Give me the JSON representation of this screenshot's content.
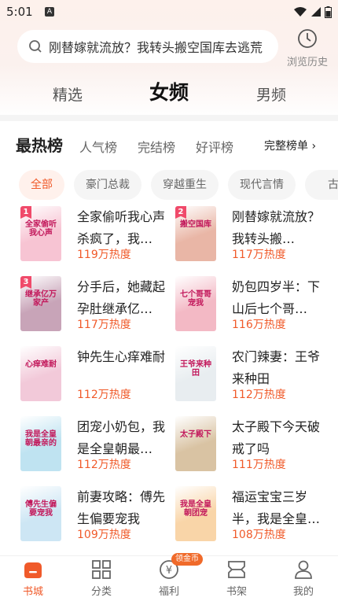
{
  "status": {
    "time": "5:01",
    "notif_letter": "A"
  },
  "search": {
    "placeholder": "刚替嫁就流放？我转头搬空国库去逃荒"
  },
  "history": {
    "label": "浏览历史"
  },
  "tabs": [
    "精选",
    "女频",
    "男频"
  ],
  "ranking": {
    "title": "最热榜",
    "tabs": [
      "人气榜",
      "完结榜",
      "好评榜"
    ],
    "full_list": "完整榜单 ›"
  },
  "chips": [
    "全部",
    "豪门总裁",
    "穿越重生",
    "现代言情",
    "古代"
  ],
  "books": [
    {
      "rank": "1",
      "title": "全家偷听我心声杀疯了，我…",
      "heat": "119万热度",
      "cover_text": "全家偷听我心声",
      "cover_color": "#f7c4d3"
    },
    {
      "rank": "2",
      "title": "刚替嫁就流放？我转头搬…",
      "heat": "117万热度",
      "cover_text": "搬空国库",
      "cover_color": "#e9b6a6"
    },
    {
      "rank": "3",
      "title": "分手后，她藏起孕肚继承亿…",
      "heat": "117万热度",
      "cover_text": "继承亿万家产",
      "cover_color": "#c8a4b8"
    },
    {
      "rank": "",
      "title": "奶包四岁半：下山后七个哥…",
      "heat": "116万热度",
      "cover_text": "七个哥哥宠我",
      "cover_color": "#f3b9c5"
    },
    {
      "rank": "",
      "title": "钟先生心痒难耐",
      "heat": "112万热度",
      "cover_text": "心痒难耐",
      "cover_color": "#f2c9d9"
    },
    {
      "rank": "",
      "title": "农门辣妻：王爷来种田",
      "heat": "112万热度",
      "cover_text": "王爷来种田",
      "cover_color": "#e8edf0"
    },
    {
      "rank": "",
      "title": "团宠小奶包，我是全皇朝最…",
      "heat": "112万热度",
      "cover_text": "我是全皇朝最亲的",
      "cover_color": "#bfe3f1"
    },
    {
      "rank": "",
      "title": "太子殿下今天破戒了吗",
      "heat": "111万热度",
      "cover_text": "太子殿下",
      "cover_color": "#d9c3a3"
    },
    {
      "rank": "",
      "title": "前妻攻略：傅先生偏要宠我",
      "heat": "109万热度",
      "cover_text": "傅先生偏要宠我",
      "cover_color": "#cde6f4"
    },
    {
      "rank": "",
      "title": "福运宝宝三岁半，我是全皇…",
      "heat": "108万热度",
      "cover_text": "我是全皇朝团宠",
      "cover_color": "#f9d5a8"
    }
  ],
  "nav": {
    "items": [
      "书城",
      "分类",
      "福利",
      "书架",
      "我的"
    ],
    "badge": "领金币"
  },
  "colors": {
    "accent": "#f05a2a",
    "rank_tag": "#f04a6a"
  }
}
